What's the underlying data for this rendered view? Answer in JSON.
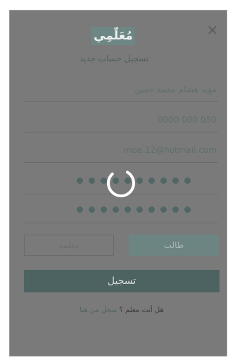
{
  "dialog": {
    "close_glyph": "✕",
    "logo_text": "مُعَلّمِي",
    "subtitle": "تسجيل حساب جديد"
  },
  "fields": {
    "name_value": "مؤيد هشام محمد حسن",
    "phone_value": "050 000 0000",
    "email_value": "moe.12@hotmail.com",
    "password_masked": "••••••••••",
    "confirm_password_masked": "••••••••••"
  },
  "roles": {
    "student_label": "طالب",
    "teacher_label": "معلمة"
  },
  "submit_label": "تسجيل",
  "footer": {
    "question": "هل أنت معلم ؟",
    "link_text": "سجل من هنا"
  },
  "colors": {
    "overlay": "#7a7a7a",
    "brand": "#6c8482",
    "submit": "#4c6361",
    "spinner": "#ffffff"
  },
  "icons": {
    "close": "close-icon",
    "loading": "loading-spinner-icon"
  }
}
